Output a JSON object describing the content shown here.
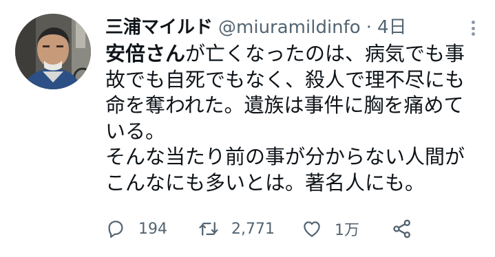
{
  "tweet": {
    "display_name": "三浦マイルド",
    "handle": "@miuramildinfo",
    "separator": "·",
    "time": "4日",
    "body_lines": [
      {
        "bold": "安倍さん",
        "rest": "が亡くなったのは、病気でも事"
      },
      {
        "bold": "",
        "rest": "故でも自死でもなく、殺人で理不尽にも"
      },
      {
        "bold": "",
        "rest": "命を奪われた。遺族は事件に胸を痛めて"
      },
      {
        "bold": "",
        "rest": "いる。"
      },
      {
        "bold": "",
        "rest": "そんな当たり前の事が分からない人間が"
      },
      {
        "bold": "",
        "rest": "こんなにも多いとは。著名人にも。"
      }
    ],
    "stats": {
      "replies": "194",
      "retweets": "2,771",
      "likes": "1万"
    },
    "icons": {
      "reply": "speech-bubble-icon",
      "retweet": "retweet-arrows-icon",
      "like": "heart-outline-icon",
      "share": "share-nodes-icon",
      "more": "vertical-ellipsis-icon"
    },
    "colors": {
      "text": "#0f1419",
      "muted": "#536471",
      "icon": "#536471"
    }
  }
}
